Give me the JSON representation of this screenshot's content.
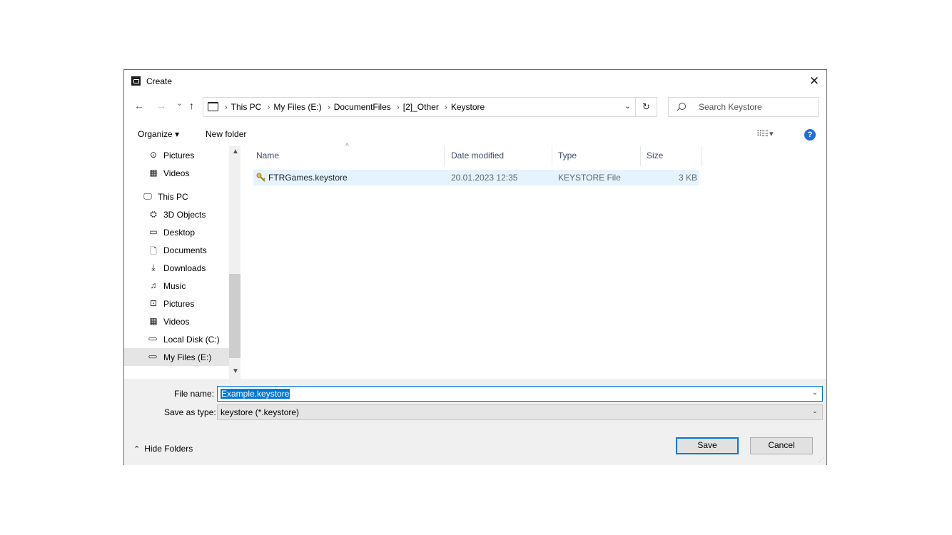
{
  "window": {
    "title": "Create",
    "close_glyph": "✕"
  },
  "nav": {
    "back": "←",
    "forward": "→",
    "recent": "⌄",
    "up": "↑",
    "breadcrumb": [
      "This PC",
      "My Files (E:)",
      "DocumentFiles",
      "[2]_Other",
      "Keystore"
    ],
    "separator": "›",
    "dropdown": "⌄",
    "refresh": "↻",
    "search_placeholder": "Search Keystore"
  },
  "toolbar": {
    "organize": "Organize ▾",
    "new_folder": "New folder",
    "view": "⠿☷ ▾",
    "help": "?"
  },
  "sidebar": {
    "items": [
      {
        "label": "Pictures",
        "icon": "pictures-icon",
        "glyph": "⊙"
      },
      {
        "label": "Videos",
        "icon": "videos-icon",
        "glyph": "▦"
      },
      {
        "label": "This PC",
        "icon": "computer-icon",
        "glyph": "🖵"
      },
      {
        "label": "3D Objects",
        "icon": "3d-objects-icon",
        "glyph": "⛭"
      },
      {
        "label": "Desktop",
        "icon": "desktop-icon",
        "glyph": "▭"
      },
      {
        "label": "Documents",
        "icon": "document-icon",
        "glyph": "🗋"
      },
      {
        "label": "Downloads",
        "icon": "download-icon",
        "glyph": "⤓"
      },
      {
        "label": "Music",
        "icon": "music-icon",
        "glyph": "♫"
      },
      {
        "label": "Pictures",
        "icon": "pictures-icon",
        "glyph": "⊡"
      },
      {
        "label": "Videos",
        "icon": "videos-icon",
        "glyph": "▦"
      },
      {
        "label": "Local Disk (C:)",
        "icon": "drive-icon",
        "glyph": "⊂⊃"
      },
      {
        "label": "My Files (E:)",
        "icon": "drive-icon",
        "glyph": "⊂⊃"
      }
    ],
    "selected": "My Files (E:)"
  },
  "filelist": {
    "columns": [
      "Name",
      "Date modified",
      "Type",
      "Size"
    ],
    "sort_glyph": "^",
    "rows": [
      {
        "name": "FTRGames.keystore",
        "date": "20.01.2023 12:35",
        "type": "KEYSTORE File",
        "size": "3 KB"
      }
    ]
  },
  "form": {
    "file_name_label": "File name:",
    "file_name_value": "Example.keystore",
    "save_type_label": "Save as type:",
    "save_type_value": "keystore (*.keystore)",
    "combo_arrow": "⌄"
  },
  "footer": {
    "hide_folders": "Hide Folders",
    "hide_glyph": "⌃",
    "save": "Save",
    "cancel": "Cancel"
  },
  "colors": {
    "accent": "#0078d7",
    "selection_row": "#e5f3ff",
    "help": "#1e6fd9"
  }
}
